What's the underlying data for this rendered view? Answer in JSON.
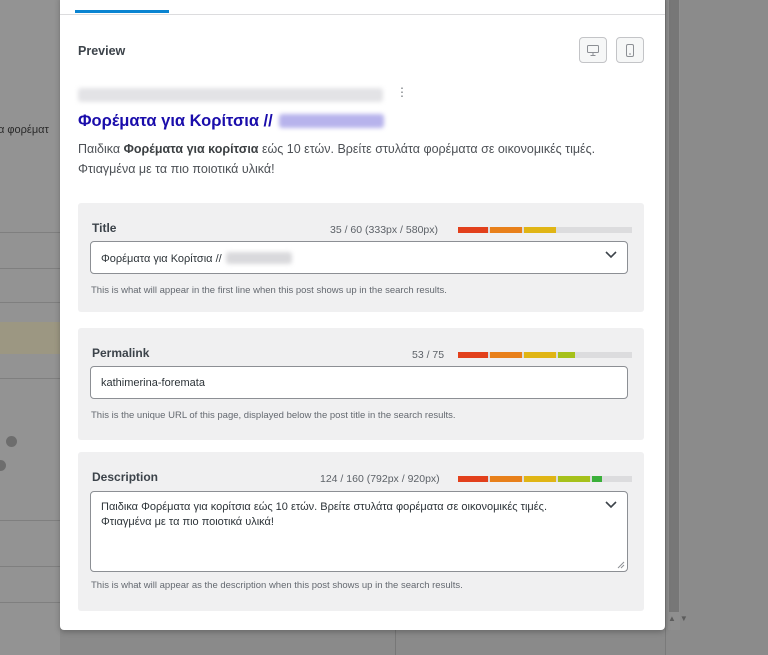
{
  "background": {
    "cropped_text": "α φορέματ"
  },
  "preview": {
    "label": "Preview",
    "desktop_icon": "desktop-icon",
    "mobile_icon": "mobile-icon",
    "serp_title": "Φορέματα για Κορίτσια //",
    "desc_pre": "Παιδικα ",
    "desc_bold": "Φορέματα για κορίτσια",
    "desc_post": " εώς 10 ετών. Βρείτε στυλάτα φορέματα σε οικονομικές τιμές. Φτιαγμένα με τα πιο ποιοτικά υλικά!"
  },
  "title_field": {
    "label": "Title",
    "counter": "35 / 60 (333px / 580px)",
    "value": "Φορέματα για Κορίτσια //",
    "hint": "This is what will appear in the first line when this post shows up in the search results.",
    "meter_fraction": 0.58
  },
  "permalink_field": {
    "label": "Permalink",
    "counter": "53 / 75",
    "value": "kathimerina-foremata",
    "hint": "This is the unique URL of this page, displayed below the post title in the search results.",
    "meter_fraction": 0.71
  },
  "description_field": {
    "label": "Description",
    "counter": "124 / 160 (792px / 920px)",
    "value": "Παιδικα Φορέματα για κορίτσια εώς 10 ετών. Βρείτε στυλάτα φορέματα σε οικονομικές τιμές. Φτιαγμένα με τα πιο ποιοτικά υλικά!",
    "hint": "This is what will appear as the description when this post shows up in the search results.",
    "meter_fraction": 0.86
  },
  "colors": {
    "meter_red": "#e2401c",
    "meter_orange": "#e8801b",
    "meter_yellow": "#e0b515",
    "meter_lime": "#a6c11b",
    "meter_green": "#3bb03a",
    "link_blue": "#1a0dab",
    "tab_accent": "#0a84d1"
  }
}
